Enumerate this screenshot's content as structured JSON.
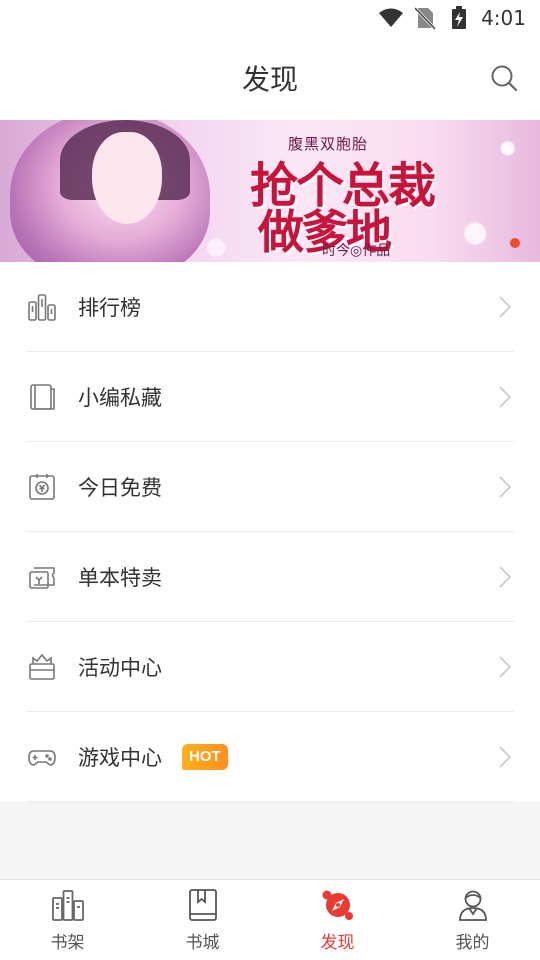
{
  "status_bar": {
    "time": "4:01"
  },
  "header": {
    "title": "发现"
  },
  "banner": {
    "subtitle": "腹黑双胞胎",
    "title_line1": "抢个总裁",
    "title_line2": "做爹地",
    "author": "时今◎作品"
  },
  "menu": {
    "items": [
      {
        "label": "排行榜",
        "icon": "ranking-icon"
      },
      {
        "label": "小编私藏",
        "icon": "book-icon"
      },
      {
        "label": "今日免费",
        "icon": "free-coupon-icon"
      },
      {
        "label": "单本特卖",
        "icon": "ticket-icon"
      },
      {
        "label": "活动中心",
        "icon": "gift-box-icon"
      },
      {
        "label": "游戏中心",
        "icon": "gamepad-icon",
        "badge": "HOT"
      }
    ]
  },
  "tabbar": {
    "tabs": [
      {
        "label": "书架",
        "active": false
      },
      {
        "label": "书城",
        "active": false
      },
      {
        "label": "发现",
        "active": true
      },
      {
        "label": "我的",
        "active": false
      }
    ]
  },
  "colors": {
    "accent": "#ea3a33",
    "hot_badge": "#ffa41c"
  }
}
